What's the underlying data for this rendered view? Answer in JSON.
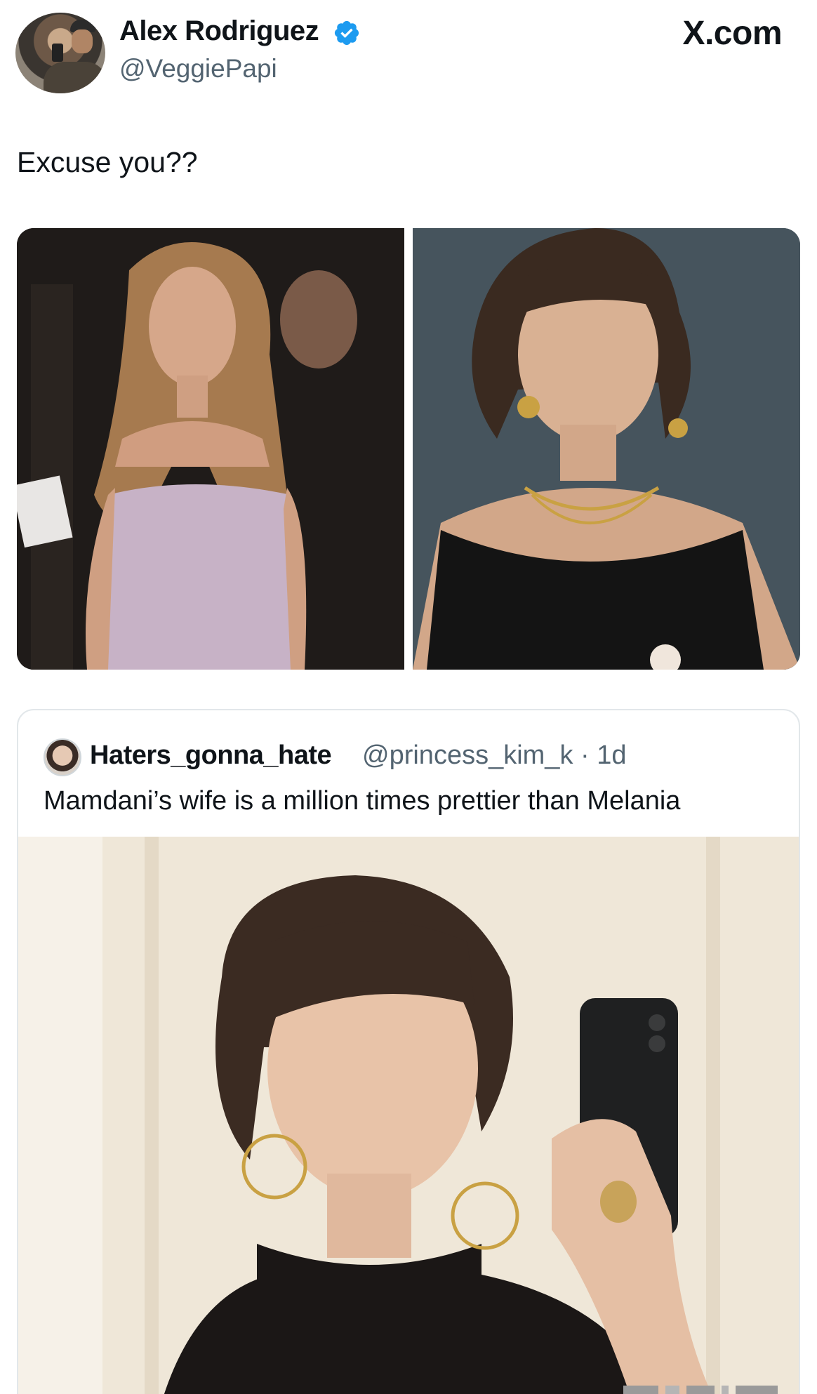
{
  "post": {
    "author_name": "Alex Rodriguez",
    "author_handle": "@VeggiePapi",
    "verified": true,
    "brand": "X.com",
    "text": "Excuse you??"
  },
  "quoted_post": {
    "author_name": "Haters_gonna_hate",
    "author_handle_time": "@princess_kim_k · 1d",
    "text": "Mamdani’s wife is a million times prettier than Melania"
  },
  "colors": {
    "text_primary": "#0f1419",
    "text_secondary": "#536471",
    "verified_blue": "#1d9bf0",
    "border": "#e2e7ea"
  },
  "icons": [
    "verified-badge-icon"
  ]
}
